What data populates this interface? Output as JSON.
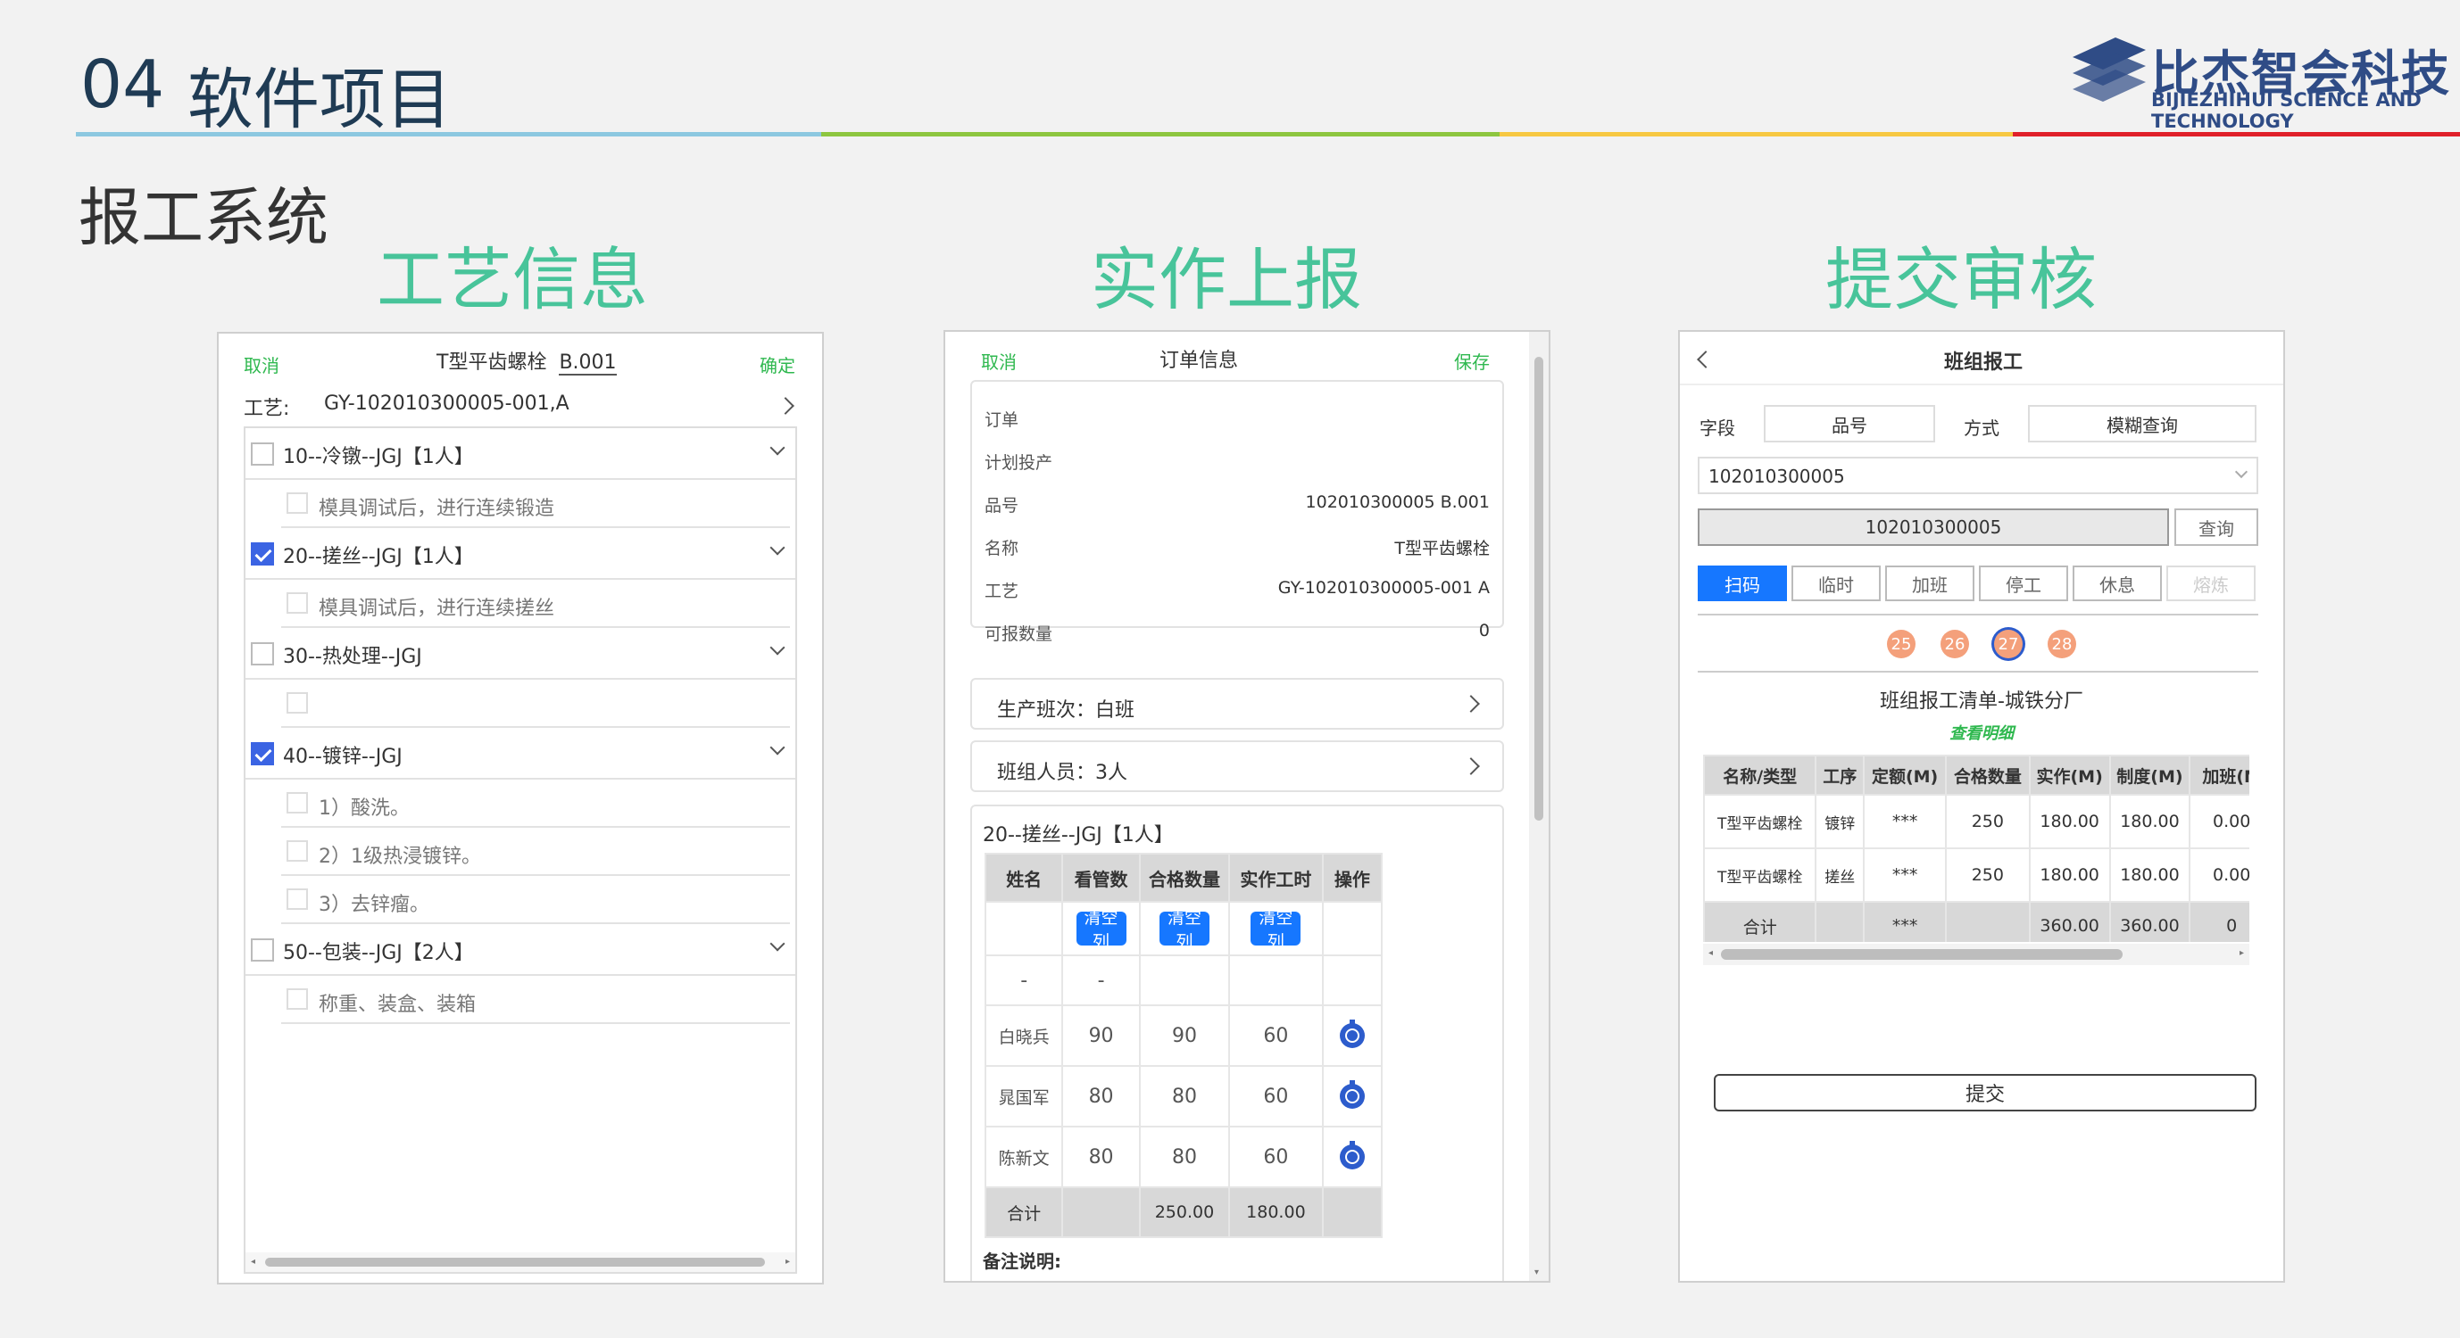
{
  "header": {
    "section_num": "04",
    "section_title": "软件项目",
    "subtitle": "报工系统",
    "logo_cn": "比杰智会科技",
    "logo_en": "BIJIEZHIHUI SCIENCE AND TECHNOLOGY",
    "line_colors": [
      "#8cc8e0",
      "#8dc63f",
      "#f7c842",
      "#e0202a"
    ]
  },
  "sections": [
    {
      "label": "工艺信息",
      "color": "#48c49a"
    },
    {
      "label": "实作上报",
      "color": "#48c49a"
    },
    {
      "label": "提交审核",
      "color": "#48c49a"
    }
  ],
  "p1": {
    "cancel": "取消",
    "title": "T型平齿螺栓",
    "code": "B.001",
    "confirm": "确定",
    "process_label": "工艺:",
    "process_value": "GY-102010300005-001,A",
    "items": [
      {
        "text": "10--冷镦--JGJ【1人】",
        "checked": false,
        "level": 0
      },
      {
        "text": "模具调试后，进行连续锻造",
        "checked": false,
        "level": 1
      },
      {
        "text": "20--搓丝--JGJ【1人】",
        "checked": true,
        "level": 0
      },
      {
        "text": "模具调试后，进行连续搓丝",
        "checked": false,
        "level": 1
      },
      {
        "text": "30--热处理--JGJ",
        "checked": false,
        "level": 0
      },
      {
        "text": "",
        "checked": false,
        "level": 1
      },
      {
        "text": "40--镀锌--JGJ",
        "checked": true,
        "level": 0
      },
      {
        "text": "1）酸洗。",
        "checked": false,
        "level": 1
      },
      {
        "text": "2）1级热浸镀锌。",
        "checked": false,
        "level": 1
      },
      {
        "text": "3）去锌瘤。",
        "checked": false,
        "level": 1
      },
      {
        "text": "50--包装--JGJ【2人】",
        "checked": false,
        "level": 0
      },
      {
        "text": "称重、装盒、装箱",
        "checked": false,
        "level": 1
      }
    ]
  },
  "p2": {
    "cancel": "取消",
    "title": "订单信息",
    "save": "保存",
    "fields": [
      {
        "label": "订单",
        "value": ""
      },
      {
        "label": "计划投产",
        "value": ""
      },
      {
        "label": "品号",
        "value": "102010300005 B.001"
      },
      {
        "label": "名称",
        "value": "T型平齿螺栓"
      },
      {
        "label": "工艺",
        "value": "GY-102010300005-001 A"
      },
      {
        "label": "可报数量",
        "value": "0"
      }
    ],
    "shift": "生产班次：白班",
    "team": "班组人员：3人",
    "op_title": "20--搓丝--JGJ【1人】",
    "headers": [
      "姓名",
      "看管数",
      "合格数量",
      "实作工时",
      "操作"
    ],
    "clear_label": "清空列",
    "dash_row": [
      "-",
      "-",
      "",
      "",
      ""
    ],
    "rows": [
      {
        "name": "白晓兵",
        "a": "90",
        "b": "90",
        "c": "60"
      },
      {
        "name": "晁国军",
        "a": "80",
        "b": "80",
        "c": "60"
      },
      {
        "name": "陈新文",
        "a": "80",
        "b": "80",
        "c": "60"
      }
    ],
    "total_label": "合计",
    "total_b": "250.00",
    "total_c": "180.00",
    "note_label": "备注说明:"
  },
  "p3": {
    "title": "班组报工",
    "field_label": "字段",
    "field_value": "品号",
    "mode_label": "方式",
    "mode_value": "模糊查询",
    "select_value": "102010300005",
    "search_value": "102010300005",
    "query": "查询",
    "tabs": [
      "扫码",
      "临时",
      "加班",
      "停工",
      "休息",
      "熔炼"
    ],
    "days": [
      "25",
      "26",
      "27",
      "28"
    ],
    "list_title": "班组报工清单-城铁分厂",
    "view_detail": "查看明细",
    "headers": [
      "名称/类型",
      "工序",
      "定额(M)",
      "合格数量",
      "实作(M)",
      "制度(M)",
      "加班(M"
    ],
    "rows": [
      [
        "T型平齿螺栓",
        "镀锌",
        "***",
        "250",
        "180.00",
        "180.00",
        "0.00"
      ],
      [
        "T型平齿螺栓",
        "搓丝",
        "***",
        "250",
        "180.00",
        "180.00",
        "0.00"
      ]
    ],
    "total": [
      "合计",
      "",
      "***",
      "",
      "360.00",
      "360.00",
      "0"
    ],
    "submit": "提交"
  }
}
